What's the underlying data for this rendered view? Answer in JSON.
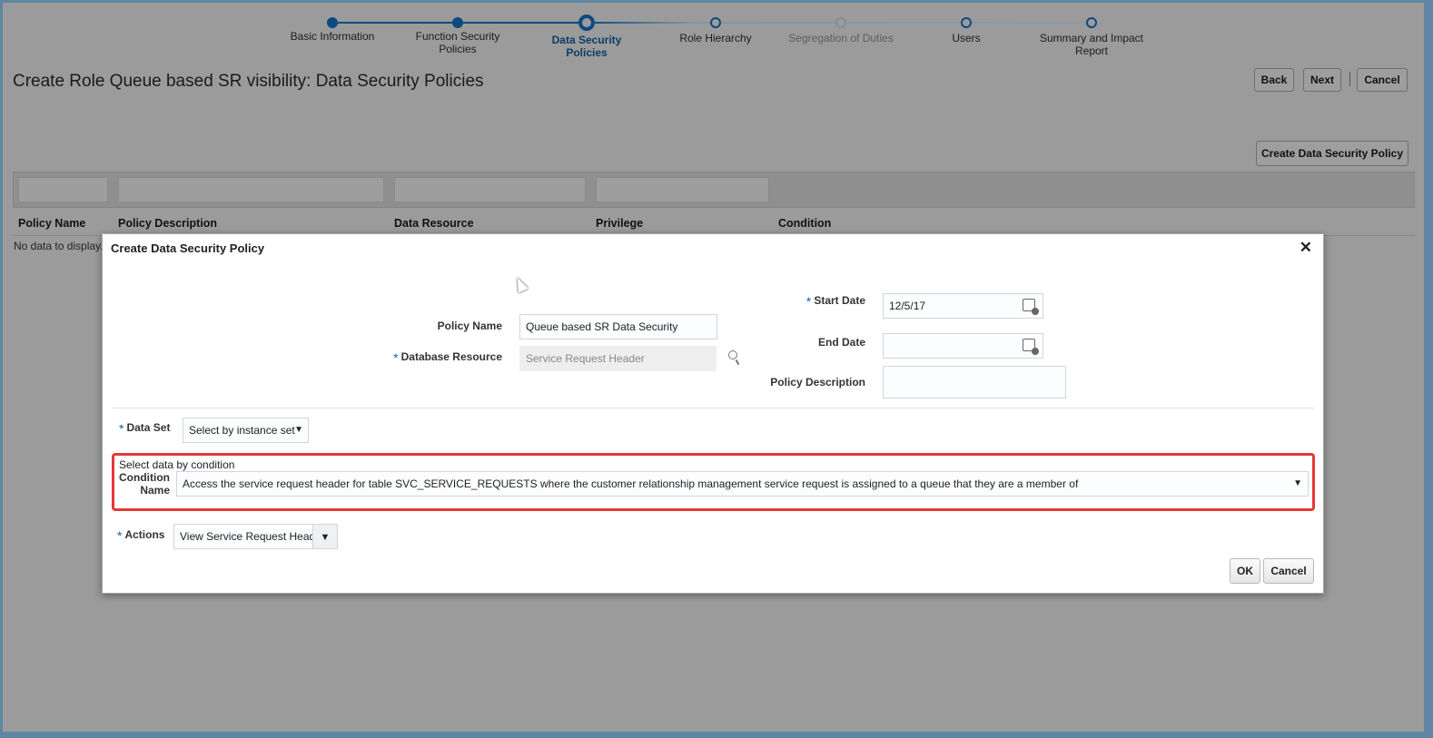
{
  "train": [
    {
      "label": "Basic Information",
      "state": "done"
    },
    {
      "label": "Function Security Policies",
      "state": "done"
    },
    {
      "label": "Data Security Policies",
      "state": "current"
    },
    {
      "label": "Role Hierarchy",
      "state": "todo"
    },
    {
      "label": "Segregation of Duties",
      "state": "disabled"
    },
    {
      "label": "Users",
      "state": "todo"
    },
    {
      "label": "Summary and Impact Report",
      "state": "todo"
    }
  ],
  "page": {
    "title": "Create Role Queue based SR visibility: Data Security Policies",
    "back": "Back",
    "next": "Next",
    "cancel": "Cancel",
    "create_policy": "Create Data Security Policy"
  },
  "table": {
    "columns": [
      "Policy Name",
      "Policy Description",
      "Data Resource",
      "Privilege",
      "Condition"
    ],
    "empty": "No data to display."
  },
  "dialog": {
    "title": "Create Data Security Policy",
    "policy_name_label": "Policy Name",
    "policy_name": "Queue based SR Data Security",
    "db_resource_label": "Database Resource",
    "db_resource": "Service Request Header",
    "start_date_label": "Start Date",
    "start_date": "12/5/17",
    "end_date_label": "End Date",
    "end_date": "",
    "policy_desc_label": "Policy Description",
    "policy_desc": "",
    "data_set_label": "Data Set",
    "data_set": "Select by instance set",
    "condition_heading": "Select data by condition",
    "condition_label": "Condition Name",
    "condition": "Access the service request header for table SVC_SERVICE_REQUESTS where the customer relationship management service request is assigned to a queue that they are a member of",
    "actions_label": "Actions",
    "actions": "View Service Request Header",
    "ok": "OK",
    "cancel": "Cancel",
    "highlight_color": "#e53935"
  }
}
